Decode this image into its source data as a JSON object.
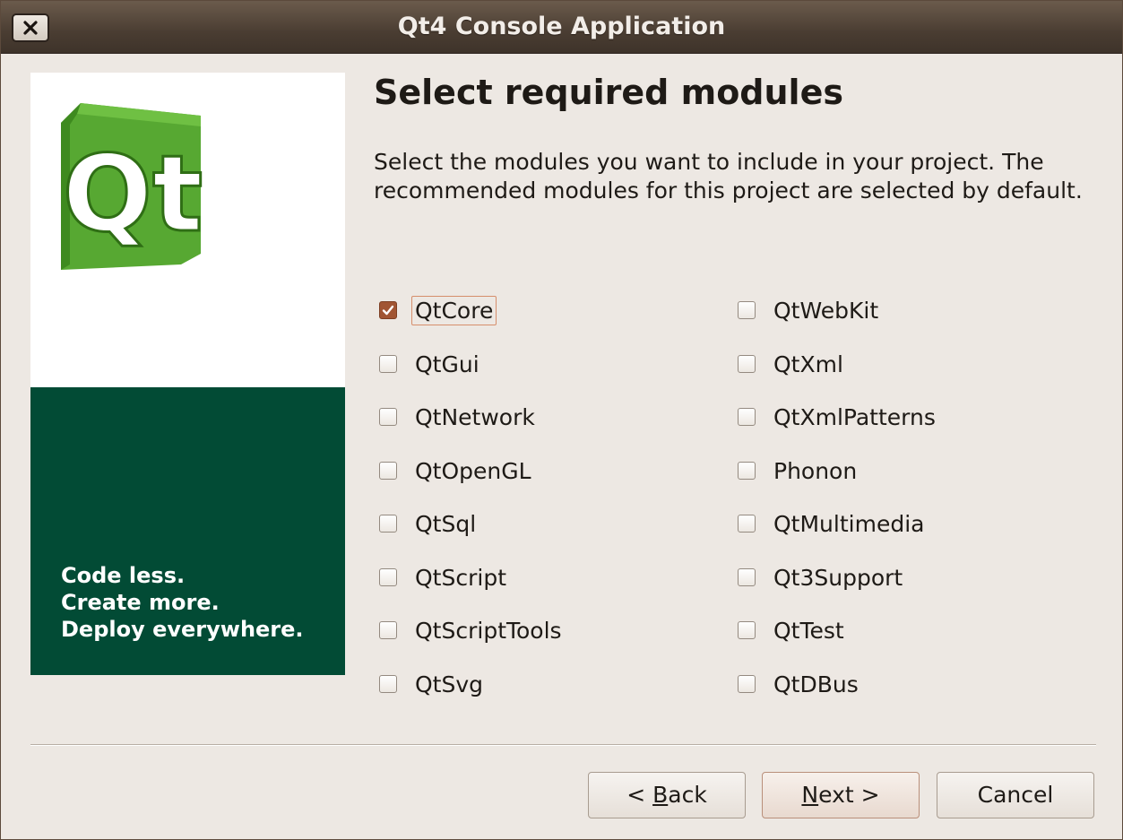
{
  "window": {
    "title": "Qt4 Console Application",
    "close_icon": "close-icon"
  },
  "side_panel": {
    "logo_text": "Qt",
    "slogan_lines": [
      "Code less.",
      "Create more.",
      "Deploy everywhere."
    ],
    "colors": {
      "logo_green": "#57a832",
      "band_green": "#024b35"
    }
  },
  "page": {
    "title": "Select required modules",
    "subtitle": "Select the modules you want to include in your project. The recommended modules for this project are selected by default."
  },
  "modules": {
    "left": [
      {
        "label": "QtCore",
        "checked": true,
        "focused": true
      },
      {
        "label": "QtGui",
        "checked": false
      },
      {
        "label": "QtNetwork",
        "checked": false
      },
      {
        "label": "QtOpenGL",
        "checked": false
      },
      {
        "label": "QtSql",
        "checked": false
      },
      {
        "label": "QtScript",
        "checked": false
      },
      {
        "label": "QtScriptTools",
        "checked": false
      },
      {
        "label": "QtSvg",
        "checked": false
      }
    ],
    "right": [
      {
        "label": "QtWebKit",
        "checked": false
      },
      {
        "label": "QtXml",
        "checked": false
      },
      {
        "label": "QtXmlPatterns",
        "checked": false
      },
      {
        "label": "Phonon",
        "checked": false
      },
      {
        "label": "QtMultimedia",
        "checked": false
      },
      {
        "label": "Qt3Support",
        "checked": false
      },
      {
        "label": "QtTest",
        "checked": false
      },
      {
        "label": "QtDBus",
        "checked": false
      }
    ]
  },
  "buttons": {
    "back": {
      "prefix": "< ",
      "mnemonic": "B",
      "rest": "ack"
    },
    "next": {
      "prefix": "",
      "mnemonic": "N",
      "rest": "ext >"
    },
    "cancel": "Cancel"
  },
  "accent_color": "#a15533"
}
